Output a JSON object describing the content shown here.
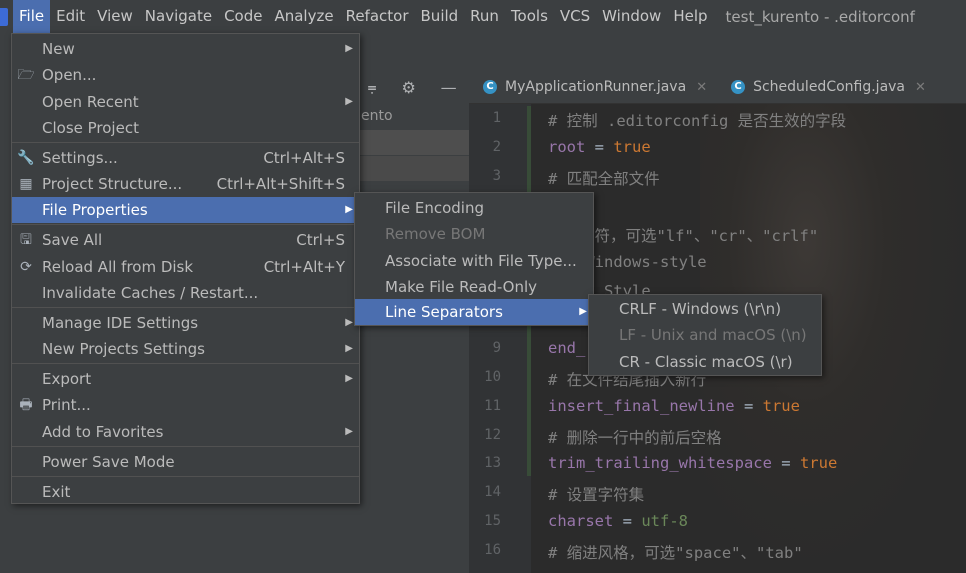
{
  "menubar": {
    "items": [
      "File",
      "Edit",
      "View",
      "Navigate",
      "Code",
      "Analyze",
      "Refactor",
      "Build",
      "Run",
      "Tools",
      "VCS",
      "Window",
      "Help"
    ],
    "title": "test_kurento - .editorconf"
  },
  "project_panel": {
    "header_icons": [
      "collapse-icon",
      "gear-icon",
      "minimize-icon"
    ],
    "row_text": "ento"
  },
  "tabs": [
    {
      "label": "MyApplicationRunner.java",
      "icon": "C"
    },
    {
      "label": "ScheduledConfig.java",
      "icon": "C"
    }
  ],
  "editor": {
    "line_numbers": [
      "1",
      "2",
      "3",
      "9",
      "10",
      "11",
      "12",
      "13",
      "14",
      "15",
      "16"
    ],
    "lines": [
      {
        "text": "# 控制 .editorconfig 是否生效的字段"
      },
      {
        "key": "root",
        "eq": " = ",
        "val": "true"
      },
      {
        "text": "# 匹配全部文件"
      },
      {
        "text": "尾换行符，可选\"lf\"、\"cr\"、\"crlf\""
      },
      {
        "text": "LF->Windows-style"
      },
      {
        "text": ">Unix Style"
      },
      {
        "text": "end_"
      },
      {
        "text": "# 在文件结尾插入新行"
      },
      {
        "key": "insert_final_newline",
        "eq": " = ",
        "val": "true"
      },
      {
        "text": "# 删除一行中的前后空格"
      },
      {
        "key": "trim_trailing_whitespace",
        "eq": " = ",
        "val": "true"
      },
      {
        "text": "# 设置字符集"
      },
      {
        "key": "charset",
        "eq": " = ",
        "val": "utf-8"
      },
      {
        "text": "# 缩进风格，可选\"space\"、\"tab\""
      }
    ]
  },
  "file_menu": {
    "items": [
      {
        "label": "New",
        "submenu": true
      },
      {
        "label": "Open...",
        "icon": "folder-icon"
      },
      {
        "label": "Open Recent",
        "submenu": true
      },
      {
        "label": "Close Project"
      },
      {
        "label": "Settings...",
        "shortcut": "Ctrl+Alt+S",
        "icon": "wrench-icon"
      },
      {
        "label": "Project Structure...",
        "shortcut": "Ctrl+Alt+Shift+S",
        "icon": "project-structure-icon"
      },
      {
        "label": "File Properties",
        "submenu": true,
        "selected": true
      },
      {
        "label": "Save All",
        "shortcut": "Ctrl+S",
        "icon": "save-icon"
      },
      {
        "label": "Reload All from Disk",
        "shortcut": "Ctrl+Alt+Y",
        "icon": "reload-icon"
      },
      {
        "label": "Invalidate Caches / Restart..."
      },
      {
        "label": "Manage IDE Settings",
        "submenu": true
      },
      {
        "label": "New Projects Settings",
        "submenu": true
      },
      {
        "label": "Export",
        "submenu": true
      },
      {
        "label": "Print...",
        "icon": "print-icon"
      },
      {
        "label": "Add to Favorites",
        "submenu": true
      },
      {
        "label": "Power Save Mode"
      },
      {
        "label": "Exit"
      }
    ]
  },
  "file_properties_menu": {
    "items": [
      {
        "label": "File Encoding"
      },
      {
        "label": "Remove BOM",
        "disabled": true
      },
      {
        "label": "Associate with File Type..."
      },
      {
        "label": "Make File Read-Only"
      },
      {
        "label": "Line Separators",
        "submenu": true,
        "selected": true
      }
    ]
  },
  "line_separators_menu": {
    "items": [
      {
        "label": "CRLF - Windows (\\r\\n)"
      },
      {
        "label": "LF - Unix and macOS (\\n)",
        "disabled": true
      },
      {
        "label": "CR - Classic macOS (\\r)"
      }
    ]
  },
  "colors": {
    "selection": "#4b6eaf",
    "menu_bg": "#3c3f41",
    "editor_bg": "#2b2b2b"
  }
}
